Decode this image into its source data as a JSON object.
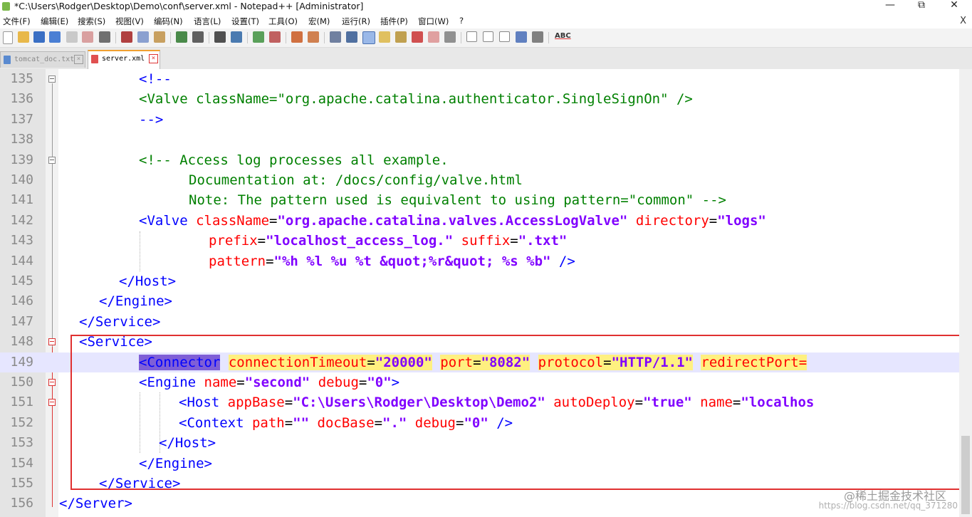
{
  "window": {
    "title": "*C:\\Users\\Rodger\\Desktop\\Demo\\conf\\server.xml - Notepad++ [Administrator]",
    "controls": [
      "—",
      "⧉",
      "✕"
    ]
  },
  "menu": {
    "items": [
      "文件(F)",
      "编辑(E)",
      "搜索(S)",
      "视图(V)",
      "编码(N)",
      "语言(L)",
      "设置(T)",
      "工具(O)",
      "宏(M)",
      "运行(R)",
      "插件(P)",
      "窗口(W)",
      "?"
    ],
    "close": "X"
  },
  "toolbar": {
    "abc_label": "ABC"
  },
  "tabs": [
    {
      "label": "tomcat_doc.txt",
      "active": false
    },
    {
      "label": "server.xml",
      "active": true
    }
  ],
  "editor": {
    "lines": [
      {
        "num": "135",
        "segs": [
          {
            "t": "<!--",
            "c": "tag"
          }
        ]
      },
      {
        "num": "136",
        "segs": [
          {
            "t": "<Valve className=\"org.apache.catalina.authenticator.SingleSignOn\" />",
            "c": "cmt"
          }
        ]
      },
      {
        "num": "137",
        "segs": [
          {
            "t": "-->",
            "c": "tag"
          }
        ]
      },
      {
        "num": "138",
        "segs": []
      },
      {
        "num": "139",
        "segs": [
          {
            "t": "<!-- Access log processes all example.",
            "c": "cmt"
          }
        ]
      },
      {
        "num": "140",
        "segs": [
          {
            "t": "Documentation at: /docs/config/valve.html",
            "c": "cmt"
          }
        ]
      },
      {
        "num": "141",
        "segs": [
          {
            "t": "Note: The pattern used is equivalent to using pattern=\"common\" -->",
            "c": "cmt"
          }
        ]
      },
      {
        "num": "142",
        "segs": [
          {
            "t": "<Valve ",
            "c": "tag"
          },
          {
            "t": "className",
            "c": "attr"
          },
          {
            "t": "=",
            "c": "eq"
          },
          {
            "t": "\"org.apache.catalina.valves.AccessLogValve\"",
            "c": "val"
          },
          {
            "t": " directory",
            "c": "attr"
          },
          {
            "t": "=",
            "c": "eq"
          },
          {
            "t": "\"logs\"",
            "c": "val"
          }
        ]
      },
      {
        "num": "143",
        "segs": [
          {
            "t": "prefix",
            "c": "attr"
          },
          {
            "t": "=",
            "c": "eq"
          },
          {
            "t": "\"localhost_access_log.\"",
            "c": "val"
          },
          {
            "t": " suffix",
            "c": "attr"
          },
          {
            "t": "=",
            "c": "eq"
          },
          {
            "t": "\".txt\"",
            "c": "val"
          }
        ]
      },
      {
        "num": "144",
        "segs": [
          {
            "t": "pattern",
            "c": "attr"
          },
          {
            "t": "=",
            "c": "eq"
          },
          {
            "t": "\"%h %l %u %t &quot;%r&quot; %s %b\"",
            "c": "val"
          },
          {
            "t": " />",
            "c": "tag"
          }
        ]
      },
      {
        "num": "145",
        "segs": [
          {
            "t": "</Host>",
            "c": "tag"
          }
        ]
      },
      {
        "num": "146",
        "segs": [
          {
            "t": "</Engine>",
            "c": "tag"
          }
        ]
      },
      {
        "num": "147",
        "segs": [
          {
            "t": "</Service>",
            "c": "tag"
          }
        ]
      },
      {
        "num": "148",
        "segs": [
          {
            "t": "<Service>",
            "c": "tag"
          }
        ]
      },
      {
        "num": "149",
        "segs": [
          {
            "t": "<Connector",
            "c": "tag hl-cur"
          },
          {
            "t": " "
          },
          {
            "t": "connectionTimeout",
            "c": "attr hl-yel"
          },
          {
            "t": "=",
            "c": "eq hl-yel"
          },
          {
            "t": "\"20000\"",
            "c": "val hl-yel"
          },
          {
            "t": " "
          },
          {
            "t": "port",
            "c": "attr hl-yel"
          },
          {
            "t": "=",
            "c": "eq hl-yel"
          },
          {
            "t": "\"8082\"",
            "c": "val hl-yel"
          },
          {
            "t": " "
          },
          {
            "t": "protocol",
            "c": "attr hl-yel"
          },
          {
            "t": "=",
            "c": "eq hl-yel"
          },
          {
            "t": "\"HTTP/1.1\"",
            "c": "val hl-yel"
          },
          {
            "t": " "
          },
          {
            "t": "redirectPort=",
            "c": "attr hl-yel"
          }
        ]
      },
      {
        "num": "150",
        "segs": [
          {
            "t": "<Engine ",
            "c": "tag"
          },
          {
            "t": "name",
            "c": "attr"
          },
          {
            "t": "=",
            "c": "eq"
          },
          {
            "t": "\"second\"",
            "c": "val"
          },
          {
            "t": " debug",
            "c": "attr"
          },
          {
            "t": "=",
            "c": "eq"
          },
          {
            "t": "\"0\"",
            "c": "val"
          },
          {
            "t": ">",
            "c": "tag"
          }
        ]
      },
      {
        "num": "151",
        "segs": [
          {
            "t": "<Host ",
            "c": "tag"
          },
          {
            "t": "appBase",
            "c": "attr"
          },
          {
            "t": "=",
            "c": "eq"
          },
          {
            "t": "\"C:\\Users\\Rodger\\Desktop\\Demo2\"",
            "c": "val"
          },
          {
            "t": " autoDeploy",
            "c": "attr"
          },
          {
            "t": "=",
            "c": "eq"
          },
          {
            "t": "\"true\"",
            "c": "val"
          },
          {
            "t": " name",
            "c": "attr"
          },
          {
            "t": "=",
            "c": "eq"
          },
          {
            "t": "\"localhos",
            "c": "val"
          }
        ]
      },
      {
        "num": "152",
        "segs": [
          {
            "t": "<Context ",
            "c": "tag"
          },
          {
            "t": "path",
            "c": "attr"
          },
          {
            "t": "=",
            "c": "eq"
          },
          {
            "t": "\"\"",
            "c": "val"
          },
          {
            "t": " docBase",
            "c": "attr"
          },
          {
            "t": "=",
            "c": "eq"
          },
          {
            "t": "\".\"",
            "c": "val"
          },
          {
            "t": " debug",
            "c": "attr"
          },
          {
            "t": "=",
            "c": "eq"
          },
          {
            "t": "\"0\"",
            "c": "val"
          },
          {
            "t": " />",
            "c": "tag"
          }
        ]
      },
      {
        "num": "153",
        "segs": [
          {
            "t": "</Host>",
            "c": "tag"
          }
        ]
      },
      {
        "num": "154",
        "segs": [
          {
            "t": "</Engine>",
            "c": "tag"
          }
        ]
      },
      {
        "num": "155",
        "segs": [
          {
            "t": "</Service>",
            "c": "tag"
          }
        ]
      },
      {
        "num": "156",
        "segs": [
          {
            "t": "</Server>",
            "c": "tag"
          }
        ]
      }
    ]
  },
  "watermark": "@稀土掘金技术社区",
  "watermark_url": "https://blog.csdn.net/qq_371280"
}
